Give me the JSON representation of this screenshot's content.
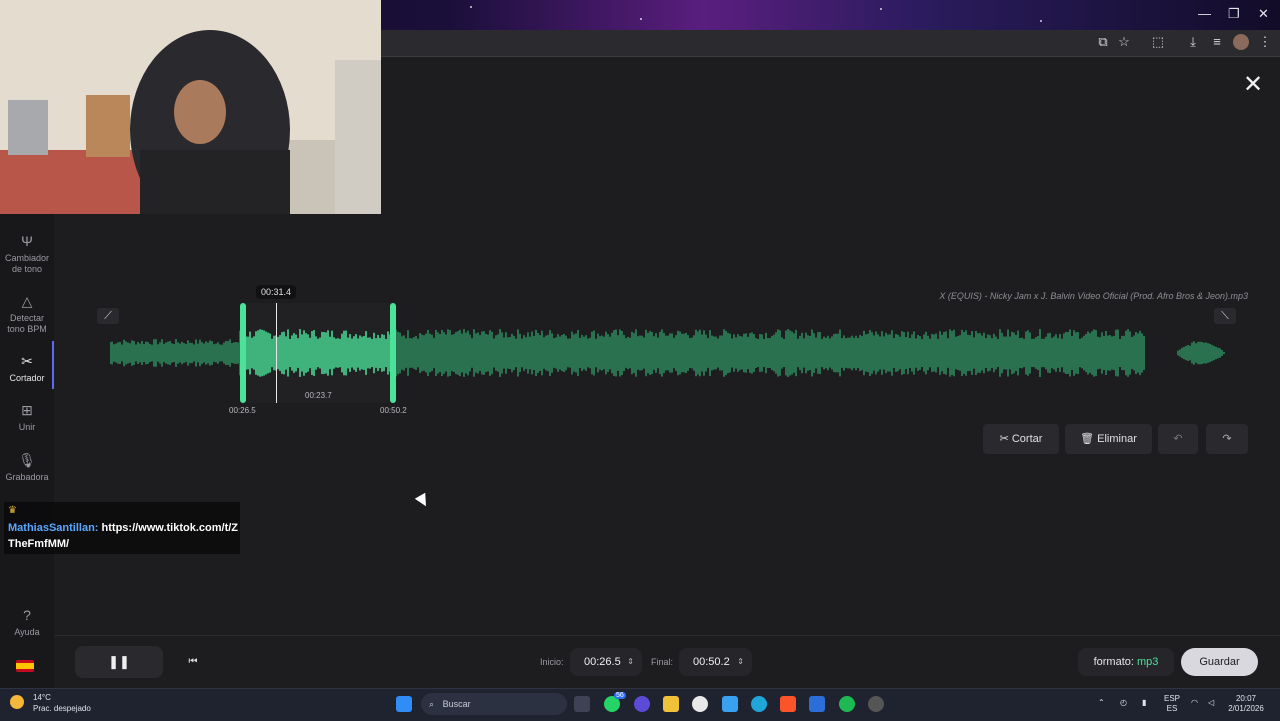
{
  "browser": {
    "window_controls": {
      "minimize": "—",
      "restore": "❐",
      "close": "✕"
    },
    "toolbar_icons": [
      "translate-icon",
      "star-icon",
      "extensions-icon",
      "download-icon",
      "media-icon",
      "profile-avatar",
      "more-icon"
    ]
  },
  "app": {
    "close_label": "✕",
    "sidebar": {
      "items": [
        {
          "label": "Cambiador de tono",
          "icon": "tuning-fork-icon",
          "active": false
        },
        {
          "label": "Detectar tono BPM",
          "icon": "metronome-icon",
          "active": false
        },
        {
          "label": "Cortador",
          "icon": "scissors-icon",
          "active": true
        },
        {
          "label": "Unir",
          "icon": "join-icon",
          "active": false
        },
        {
          "label": "Grabadora",
          "icon": "microphone-icon",
          "active": false
        }
      ],
      "help_label": "Ayuda"
    },
    "editor": {
      "filename": "X (EQUIS) - Nicky Jam x J. Balvin Video Oficial (Prod. Afro Bros & Jeon).mp3",
      "playhead_time": "00:31.4",
      "selection_start": "00:26.5",
      "selection_end": "00:50.2",
      "selection_duration": "00:23.7",
      "accent_color": "#4be39a",
      "wave_color": "#2f8f5f",
      "actions": {
        "cut": "Cortar",
        "delete": "Eliminar",
        "undo": "↶",
        "redo": "↷"
      }
    },
    "bottom_bar": {
      "pause_label": "❚❚",
      "prev_label": "⏮",
      "start_label": "Inicio:",
      "start_value": "00:26.5",
      "end_label": "Final:",
      "end_value": "00:50.2",
      "format_label": "formato:",
      "format_value": "mp3",
      "save_label": "Guardar"
    }
  },
  "overlay_chat": {
    "user": "MathiasSantillan:",
    "message": "https://www.tiktok.com/t/ZTheFmfMM/"
  },
  "taskbar": {
    "temperature": "14°C",
    "weather": "Prac. despejado",
    "search_placeholder": "Buscar",
    "whatsapp_badge": "56",
    "language": "ESP",
    "region": "ES",
    "time": "20:07",
    "date": "2/01/2026"
  }
}
